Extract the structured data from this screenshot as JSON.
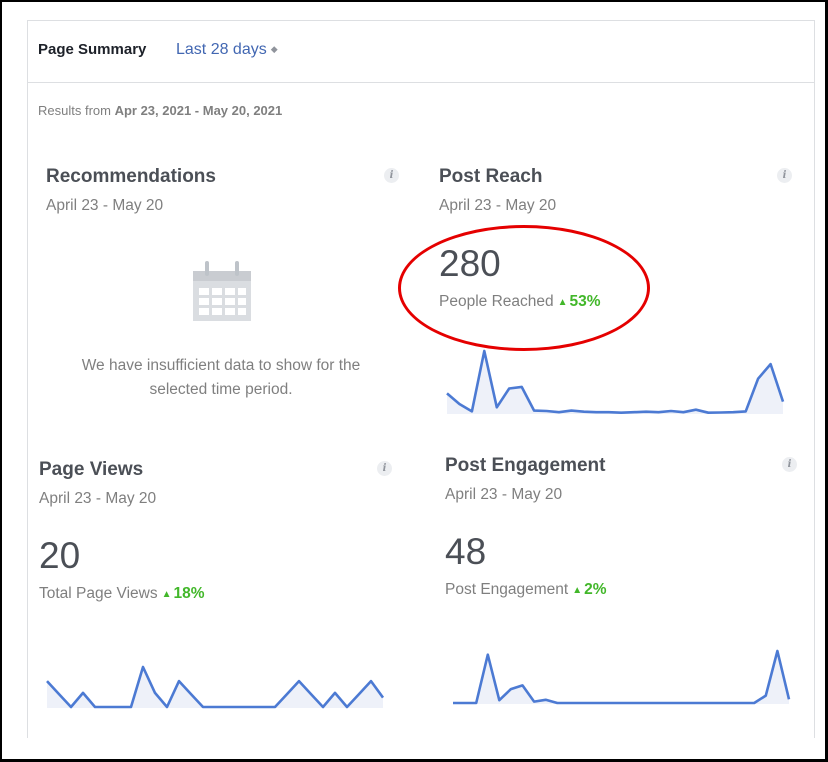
{
  "header": {
    "title": "Page Summary",
    "range_label": "Last 28 days",
    "results_prefix": "Results from ",
    "results_range": "Apr 23, 2021 - May 20, 2021"
  },
  "cards": {
    "recommendations": {
      "title": "Recommendations",
      "date": "April 23 - May 20",
      "empty_line1": "We have insufficient data to show for the",
      "empty_line2": "selected time period."
    },
    "post_reach": {
      "title": "Post Reach",
      "date": "April 23 - May 20",
      "value": "280",
      "label": "People Reached",
      "delta": "53%",
      "trend": [
        1.2,
        0.55,
        0.1,
        3.8,
        0.35,
        1.5,
        1.6,
        0.15,
        0.12,
        0.05,
        0.15,
        0.08,
        0.05,
        0.05,
        0.02,
        0.05,
        0.08,
        0.05,
        0.12,
        0.05,
        0.2,
        0.02,
        0.03,
        0.05,
        0.1,
        2.1,
        3.0,
        0.7
      ]
    },
    "page_views": {
      "title": "Page Views",
      "date": "April 23 - May 20",
      "value": "20",
      "label": "Total Page Views",
      "delta": "18%",
      "trend": [
        1.1,
        0.55,
        0,
        0.6,
        0,
        0,
        0,
        0,
        1.7,
        0.6,
        0,
        1.1,
        0.55,
        0,
        0,
        0,
        0,
        0,
        0,
        0,
        0.55,
        1.1,
        0.55,
        0,
        0.6,
        0,
        0.55,
        1.1,
        0.4
      ]
    },
    "post_engagement": {
      "title": "Post Engagement",
      "date": "April 23 - May 20",
      "value": "48",
      "label": "Post Engagement",
      "delta": "2%",
      "trend": [
        0,
        0,
        0,
        5.2,
        0.3,
        1.5,
        1.9,
        0.15,
        0.35,
        0,
        0,
        0,
        0,
        0,
        0,
        0,
        0,
        0,
        0,
        0,
        0,
        0,
        0,
        0,
        0,
        0,
        0,
        0.8,
        5.6,
        0.4
      ]
    }
  },
  "colors": {
    "link": "#4267b2",
    "spark_line": "#4c7ad3",
    "spark_fill": "#eef1f9",
    "delta_up": "#42b72a",
    "highlight_oval": "#e50000"
  },
  "icons": {
    "range_toggle": "sort-arrows-icon",
    "info": "info-icon",
    "empty_state": "calendar-icon",
    "delta": "triangle-up-icon"
  }
}
